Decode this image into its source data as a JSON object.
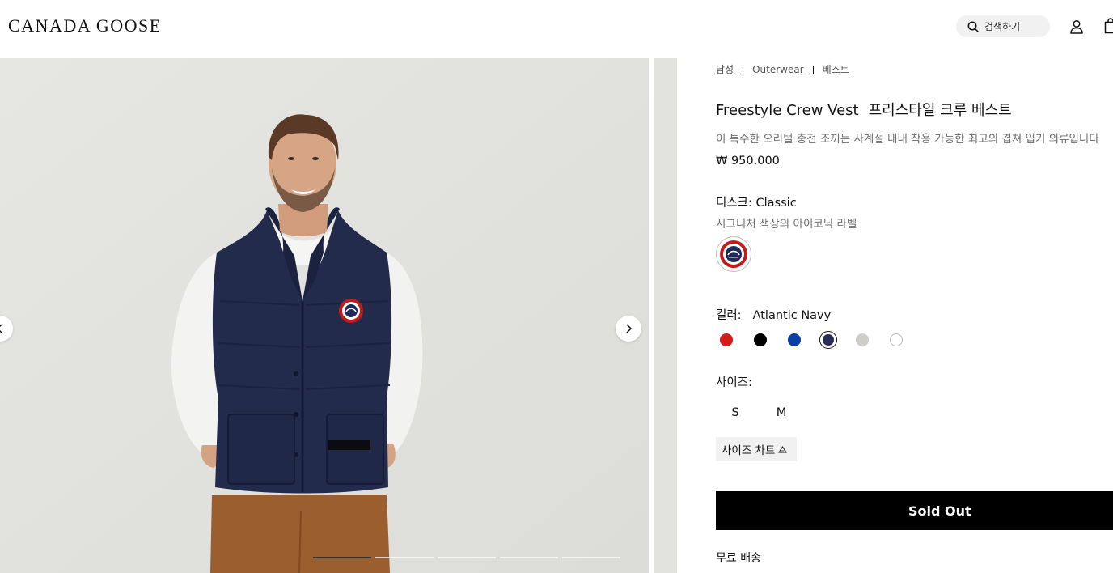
{
  "header": {
    "logo": "CANADA GOOSE",
    "search_label": "검색하기",
    "icons": [
      "search-icon",
      "account-icon",
      "bag-icon"
    ]
  },
  "gallery": {
    "slide_count": 5,
    "active_slide": 1,
    "icons": [
      "chevron-left-icon",
      "chevron-right-icon"
    ],
    "patch_label": "CANADA GOOSE"
  },
  "breadcrumb": [
    "남성",
    "Outerwear",
    "베스트"
  ],
  "product": {
    "name_en": "Freestyle Crew Vest",
    "name_ko": "프리스타일 크루 베스트",
    "description": "이 특수한 오리털 충전 조끼는 사계절 내내 착용 가능한 최고의 겹쳐 입기 의류입니다",
    "price": "₩ 950,000"
  },
  "disc": {
    "label": "디스크: Classic",
    "subtitle": "시그니처 색상의 아이코닉 라벨"
  },
  "color": {
    "label": "컬러:",
    "selected": "Atlantic Navy",
    "swatches": [
      {
        "hex": "#d51a1a",
        "selected": false
      },
      {
        "hex": "#000000",
        "selected": false
      },
      {
        "hex": "#0a3fa8",
        "selected": false
      },
      {
        "hex": "#2a2c57",
        "selected": true
      },
      {
        "hex": "#cfcdc7",
        "selected": false
      },
      {
        "hex": "#ffffff",
        "selected": false
      }
    ]
  },
  "size": {
    "label": "사이즈:",
    "options": [
      "S",
      "M"
    ],
    "chart_label": "사이즈 차트",
    "chart_icon": "ruler-icon"
  },
  "cta": {
    "label": "Sold Out"
  },
  "shipping": {
    "label": "무료 배송"
  }
}
